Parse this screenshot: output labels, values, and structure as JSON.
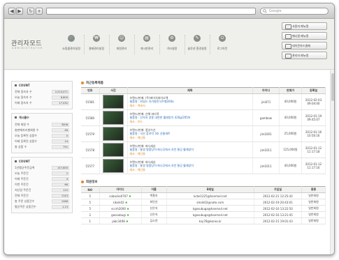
{
  "browser": {
    "search_placeholder": "Google",
    "back": "◀",
    "forward": "▶",
    "reload": "↻",
    "add": "+"
  },
  "brand": {
    "title": "관리자모드",
    "subtitle": "ADMINISTRATOR"
  },
  "topnav": [
    {
      "label": "쇼핑몰관리설정",
      "icon": "cart-icon"
    },
    {
      "label": "결제관리설정",
      "icon": "money-icon"
    },
    {
      "label": "회원관리",
      "icon": "member-icon"
    },
    {
      "label": "게시판관리",
      "icon": "board-icon"
    },
    {
      "label": "기타설정",
      "icon": "settings-icon"
    },
    {
      "label": "솔루션 환경설정",
      "icon": "tools-icon"
    },
    {
      "label": "로그아웃",
      "icon": "logout-icon"
    }
  ],
  "quick": [
    {
      "label": "사용자 메뉴얼"
    },
    {
      "label": "메니얼 메뉴얼"
    },
    {
      "label": "데이콘카드결제"
    },
    {
      "label": "관리자 메뉴얼"
    }
  ],
  "sidebar": {
    "count": {
      "title": "COUNT",
      "rows": [
        {
          "label": "전체 접속자 수",
          "value": "2,510,071"
        },
        {
          "label": "오늘 접속자 수",
          "value": "8,600"
        },
        {
          "label": "어제 접속자 수",
          "value": "17,032"
        }
      ]
    },
    "board": {
      "title": "게시물수",
      "rows": [
        {
          "label": "전체 회원 수",
          "value": "3006"
        },
        {
          "label": "총판매자리셀회원 수",
          "value": "46"
        },
        {
          "label": "오늘 등록된 상품수",
          "value": "0"
        },
        {
          "label": "어제 등록된 상품수",
          "value": "14"
        },
        {
          "label": "총 상품 수",
          "value": "791"
        }
      ]
    },
    "orders": {
      "title": "COUNT",
      "rows": [
        {
          "label": "1년평균주문금액",
          "value": "157,805"
        },
        {
          "label": "오늘 주문건",
          "value": "2"
        },
        {
          "label": "어제 주문건",
          "value": "4"
        },
        {
          "label": "이번 주문건",
          "value": "66"
        },
        {
          "label": "지난달 주문건",
          "value": "115"
        },
        {
          "label": "전체 주문건",
          "value": "1143"
        },
        {
          "label": "총 주문 상품건수",
          "value": "1286"
        },
        {
          "label": "평균주문 상품건수",
          "value": "1.13"
        }
      ]
    }
  },
  "recent_products": {
    "title": "최근등록제품",
    "headers": [
      "번호",
      "사진",
      "제목",
      "아이디",
      "판매가",
      "등록일"
    ],
    "rows": [
      {
        "no": "15581",
        "brand": "브랜드/판매: (주)에이치와이오렉",
        "name": "물품명 : 와일드 자가발전식주행200a",
        "cat": "제조 : 액세서",
        "id": "jini071",
        "price": "40,000원",
        "date": "2012-02-03 09:04:00"
      },
      {
        "no": "15580",
        "brand": "브랜드/판매: 산해 바다목",
        "name": "물품명 : 산속의 양종 내면한 활레방이 420g/205마",
        "cat": "제조 : 로드",
        "id": "gambow",
        "price": "40,000원",
        "date": "2012-01-19 09:45:07"
      },
      {
        "no": "15579",
        "brand": "브랜드/판매: 중앙수산",
        "name": "물품명 : 국산 참꼬막 3호 선물세트",
        "cat": "제조 : 해산물",
        "id": "jim1001",
        "price": "25,000원",
        "date": "2012-01-16 10:56:16"
      },
      {
        "no": "15578",
        "brand": "브랜드/판매: 바다세상",
        "name": "물품명 : 통영 명품당이-파나무에서 자란 통당 활레방이",
        "cat": "제조 : 해산물",
        "id": "jim1011",
        "price": "125,000원",
        "date": "2012-01-12 11:17:18"
      },
      {
        "no": "15577",
        "brand": "브랜드/판매: 바다세상",
        "name": "물품명 : 통영 명품당이-파나무에서 자란 통당 활레방이",
        "cat": "제조 : 해산물",
        "id": "jim1011",
        "price": "40,000원",
        "date": "2012-01-12 11:17:16"
      }
    ]
  },
  "members": {
    "title": "회원정보",
    "headers": [
      "NO",
      "아이디",
      "이름",
      "E메일",
      "가입일",
      "종류"
    ],
    "rows": [
      {
        "no": "5",
        "id": "cobacko0707",
        "name": "백철숙",
        "email": "kcbe1225@hanmail.net",
        "joined": "2012-02-21 12:25:42",
        "type": "일반회원"
      },
      {
        "no": "5",
        "id": "siksik02",
        "name": "최민선",
        "email": "siksik02@nate.com",
        "joined": "2012-02-19 20:43:01",
        "type": "일반회원"
      },
      {
        "no": "5",
        "id": "sccrh2000",
        "name": "신은숙",
        "email": "kgosubuga@hanmail.net",
        "joined": "2012-02-16 13:22:50",
        "type": "일반회원"
      },
      {
        "no": "2",
        "id": "goosubugi",
        "name": "신은숙",
        "email": "kgosubuga@hanmail.net",
        "joined": "2012-02-16 13:21:45",
        "type": "일반회원"
      },
      {
        "no": "1",
        "id": "jabc3408",
        "name": "김소연",
        "email": "ksy78@korea.kr",
        "joined": "2012-02-15 19:01:43",
        "type": "일반회원"
      }
    ]
  }
}
